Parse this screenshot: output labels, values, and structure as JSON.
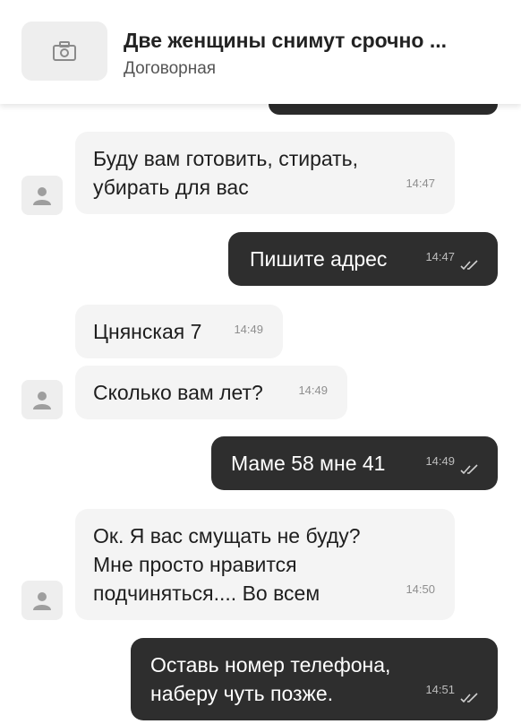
{
  "header": {
    "title": "Две женщины снимут срочно ...",
    "price": "Договорная"
  },
  "messages": [
    {
      "direction": "in",
      "lines": [
        "Буду вам готовить, стирать,",
        "убирать для вас"
      ],
      "time": "14:47"
    },
    {
      "direction": "out",
      "lines": [
        "Пишите адрес"
      ],
      "time": "14:47",
      "status": "read"
    },
    {
      "direction": "in",
      "lines": [
        "Цнянская 7"
      ],
      "time": "14:49"
    },
    {
      "direction": "in",
      "lines": [
        "Сколько вам лет?"
      ],
      "time": "14:49"
    },
    {
      "direction": "out",
      "lines": [
        "Маме 58 мне 41"
      ],
      "time": "14:49",
      "status": "read"
    },
    {
      "direction": "in",
      "lines": [
        "Ок. Я вас смущать не буду?",
        "Мне просто нравится",
        "подчиняться.... Во всем"
      ],
      "time": "14:50"
    },
    {
      "direction": "out",
      "lines": [
        "Оставь номер телефона,",
        "наберу чуть позже."
      ],
      "time": "14:51",
      "status": "read"
    }
  ],
  "icons": {
    "thumbnail": "camera-icon",
    "avatar": "user-icon",
    "read_status": "double-check-icon"
  },
  "colors": {
    "outgoing_bubble": "#2e2e2e",
    "incoming_bubble": "#f4f4f4",
    "avatar_bg": "#eeeeee"
  }
}
